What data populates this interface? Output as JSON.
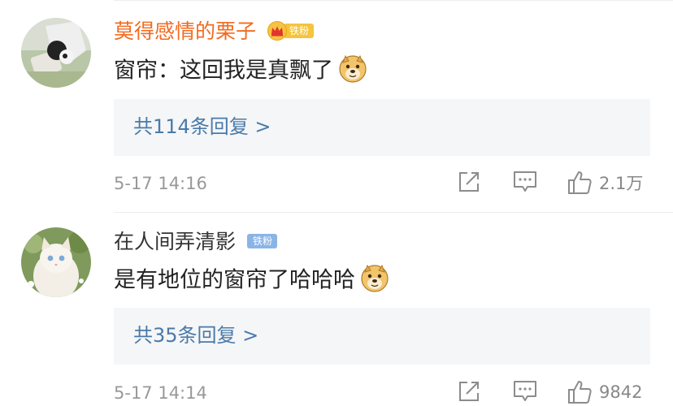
{
  "comments": [
    {
      "username": "莫得感情的栗子",
      "badge": "铁粉",
      "text": "窗帘：这回我是真飘了",
      "reply_link": "共114条回复 >",
      "time": "5-17 14:16",
      "likes": "2.1万"
    },
    {
      "username": "在人间弄清影",
      "badge": "铁粉",
      "text": "是有地位的窗帘了哈哈哈",
      "reply_link": "共35条回复 >",
      "time": "5-17 14:14",
      "likes": "9842"
    }
  ],
  "icons": {
    "share": "share-icon",
    "reply": "comment-icon",
    "like": "thumbs-up-icon",
    "emoji": "doge-emoji-icon",
    "crown": "crown-icon"
  },
  "colors": {
    "vip_name": "#f36b20",
    "name": "#333333",
    "link": "#4a7aa8",
    "meta": "#999999",
    "reply_box": "#f5f6f8",
    "badge_gold": "#f5c43c",
    "badge_blue": "#8ab4e6"
  }
}
